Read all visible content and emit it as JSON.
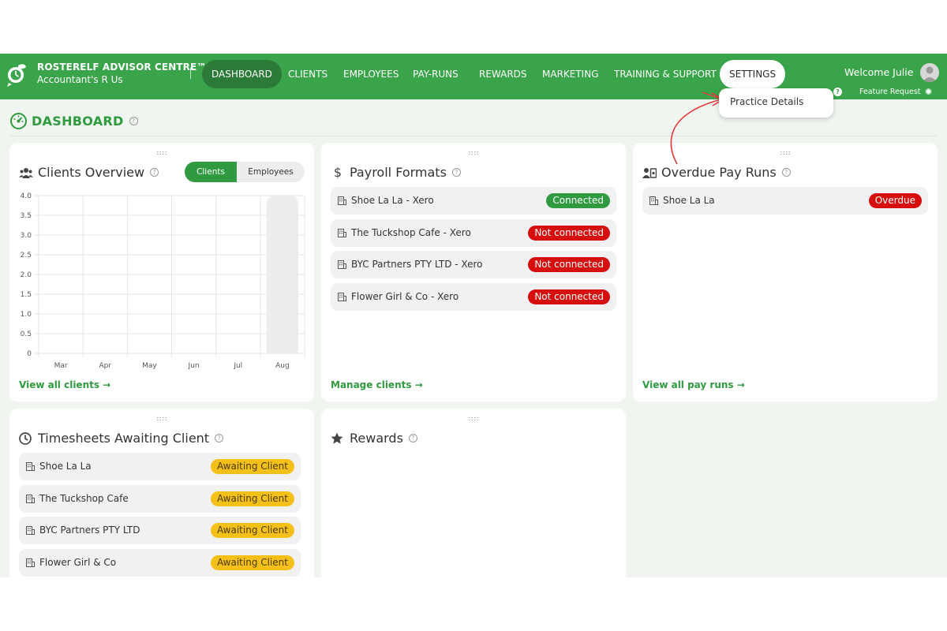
{
  "brand": {
    "title": "ROSTERELF ADVISOR CENTRE™",
    "subtitle": "Accountant's R Us"
  },
  "nav": {
    "items": [
      {
        "label": "DASHBOARD"
      },
      {
        "label": "CLIENTS"
      },
      {
        "label": "EMPLOYEES"
      },
      {
        "label": "PAY-RUNS"
      },
      {
        "label": "REWARDS"
      },
      {
        "label": "MARKETING"
      },
      {
        "label": "TRAINING & SUPPORT"
      },
      {
        "label": "SETTINGS"
      }
    ]
  },
  "user": {
    "welcome": "Welcome Julie",
    "feature_request": "Feature Request"
  },
  "dropdown": {
    "item": "Practice Details"
  },
  "page": {
    "title": "DASHBOARD"
  },
  "clients_overview": {
    "title": "Clients Overview",
    "toggle": {
      "on": "Clients",
      "off": "Employees"
    },
    "link": "View all clients →"
  },
  "payroll_formats": {
    "title": "Payroll Formats",
    "link": "Manage clients →",
    "rows": [
      {
        "label": "Shoe La La - Xero",
        "status": "Connected"
      },
      {
        "label": "The Tuckshop Cafe - Xero",
        "status": "Not connected"
      },
      {
        "label": "BYC Partners PTY LTD - Xero",
        "status": "Not connected"
      },
      {
        "label": "Flower Girl & Co - Xero",
        "status": "Not connected"
      }
    ]
  },
  "overdue": {
    "title": "Overdue Pay Runs",
    "link": "View all pay runs →",
    "rows": [
      {
        "label": "Shoe La La",
        "status": "Overdue"
      }
    ]
  },
  "timesheets": {
    "title": "Timesheets Awaiting Client",
    "rows": [
      {
        "label": "Shoe La La",
        "status": "Awaiting Client"
      },
      {
        "label": "The Tuckshop Cafe",
        "status": "Awaiting Client"
      },
      {
        "label": "BYC Partners PTY LTD",
        "status": "Awaiting Client"
      },
      {
        "label": "Flower Girl & Co",
        "status": "Awaiting Client"
      }
    ]
  },
  "rewards": {
    "title": "Rewards"
  },
  "colors": {
    "brand": "#3aa44a",
    "connected": "#2f9a3f",
    "not_connected": "#d60e0e",
    "awaiting": "#f5c018"
  },
  "chart_data": {
    "type": "bar",
    "categories": [
      "Mar",
      "Apr",
      "May",
      "Jun",
      "Jul",
      "Aug"
    ],
    "values": [
      0,
      0,
      0,
      0,
      0,
      4
    ],
    "yticks": [
      "0",
      "0.5",
      "1.0",
      "1.5",
      "2.0",
      "2.5",
      "3.0",
      "3.5",
      "4.0"
    ],
    "ylim": [
      0,
      4
    ],
    "grid": true,
    "bar_color": "#eceeec"
  }
}
